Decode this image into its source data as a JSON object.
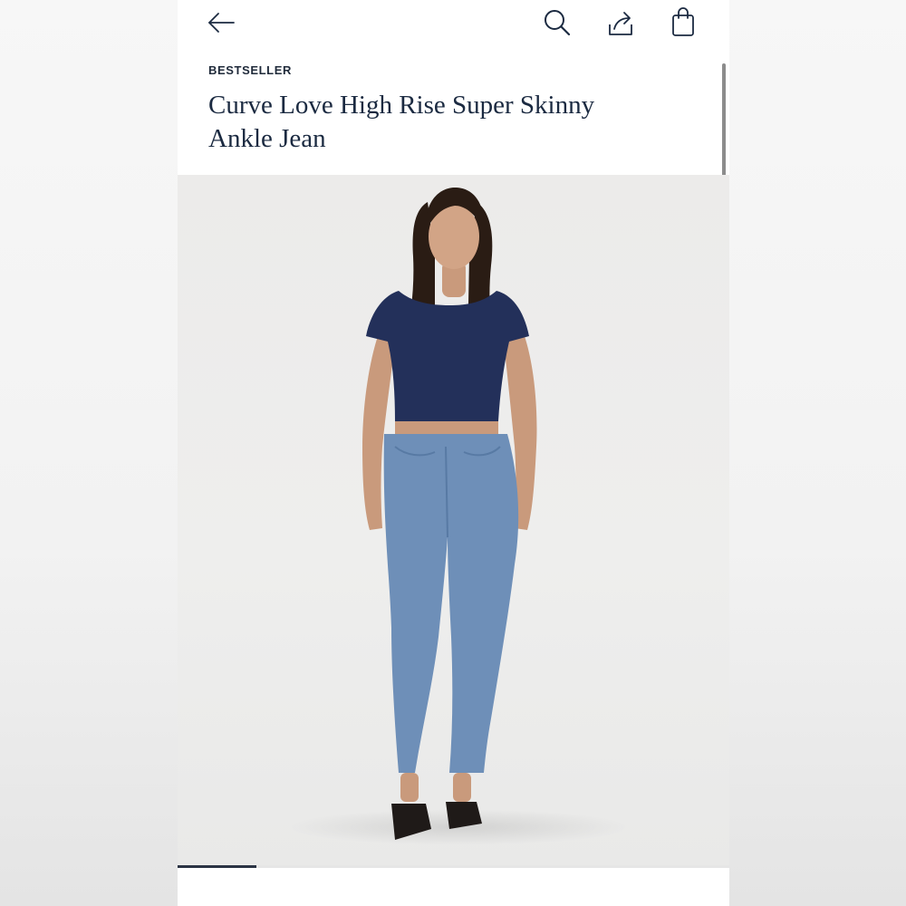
{
  "product": {
    "badge": "BESTSELLER",
    "title": "Curve Love High Rise Super Skinny Ankle Jean"
  },
  "nav": {
    "back_icon": "arrow-left-icon",
    "search_icon": "search-icon",
    "share_icon": "share-icon",
    "bag_icon": "shopping-bag-icon"
  },
  "gallery": {
    "progress_fraction": 0.143
  },
  "colors": {
    "text_navy": "#1b2a41",
    "progress": "#2b3444",
    "top_navy": "#23305a",
    "denim": "#6e8fb8"
  }
}
